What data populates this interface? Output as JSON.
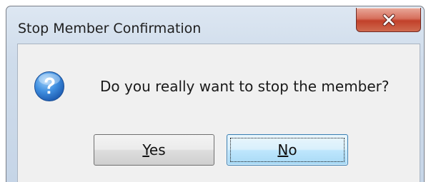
{
  "dialog": {
    "title": "Stop Member Confirmation",
    "message": "Do you really want to stop the member?",
    "icon": "question-icon",
    "close_icon": "close-icon",
    "buttons": {
      "yes": {
        "mnemonic": "Y",
        "rest": "es"
      },
      "no": {
        "mnemonic": "N",
        "rest": "o"
      }
    },
    "default_button": "no"
  },
  "colors": {
    "close_button": "#c2412a",
    "focused_button_border": "#3c7fb1",
    "question_icon": "#2f7ed8"
  }
}
